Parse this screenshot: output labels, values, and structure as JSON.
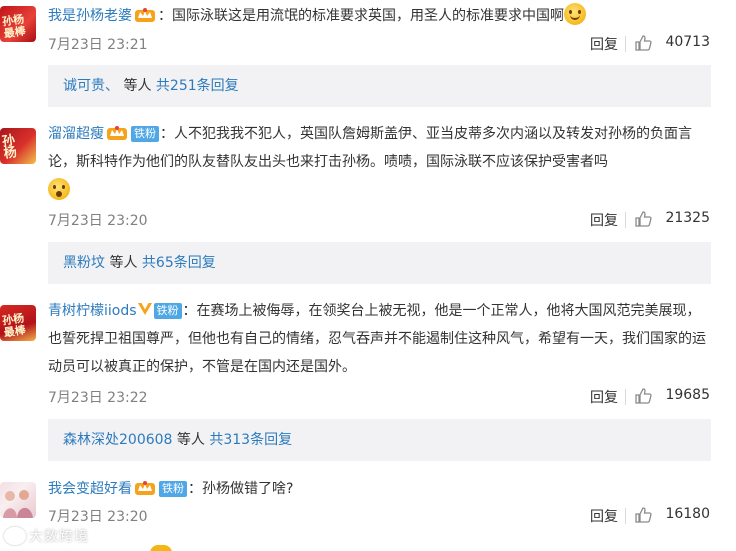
{
  "comments": [
    {
      "username": "我是孙杨老婆",
      "fan_badge": "",
      "text": "：国际泳联这是用流氓的标准要求英国，用圣人的标准要求中国啊",
      "time": "7月23日 23:21",
      "reply_label": "回复",
      "likes": "40713",
      "subreply": {
        "who": "诚可贵、",
        "mid": " 等人 ",
        "count": "共251条回复"
      },
      "avatar_icon": "avatar-red-image",
      "emoji": "smile-emoji"
    },
    {
      "username": "溜溜超瘦",
      "fan_badge": "铁粉",
      "text": "：人不犯我我不犯人，英国队詹姆斯盖伊、亚当皮蒂多次内涵以及转发对孙杨的负面言论，斯科特作为他们的队友替队友出头也来打击孙杨。啧啧，国际泳联不应该保护受害者吗",
      "time": "7月23日 23:20",
      "reply_label": "回复",
      "likes": "21325",
      "subreply": {
        "who": "黑粉坟",
        "mid": " 等人 ",
        "count": "共65条回复"
      },
      "avatar_icon": "avatar-red-calligraphy",
      "emoji": "surprised-emoji"
    },
    {
      "username": "青树柠檬iiods",
      "fan_badge": "铁粉",
      "text": "：在赛场上被侮辱，在领奖台上被无视，他是一个正常人，他将大国风范完美展现，也誓死捍卫祖国尊严，但他也有自己的情绪，忍气吞声并不能遏制住这种风气，希望有一天，我们国家的运动员可以被真正的保护，不管是在国内还是国外。",
      "time": "7月23日 23:22",
      "reply_label": "回复",
      "likes": "19685",
      "subreply": {
        "who": "森林深处200608",
        "mid": " 等人 ",
        "count": "共313条回复"
      },
      "avatar_icon": "avatar-red-image",
      "emoji": ""
    },
    {
      "username": "我会变超好看",
      "fan_badge": "铁粉",
      "text": "：孙杨做错了啥?",
      "time": "7月23日 23:20",
      "reply_label": "回复",
      "likes": "16180",
      "avatar_icon": "avatar-pink-photo",
      "emoji": ""
    }
  ],
  "avatar_text": {
    "a1": "孙杨\n最棒",
    "a3": "孙杨\n最棒"
  },
  "watermark": "大数跨境",
  "colors": {
    "link": "#2c7bbd",
    "fan_badge": "#4fa7e6",
    "subreply_bg": "#f2f2f5",
    "meta": "#808080"
  }
}
